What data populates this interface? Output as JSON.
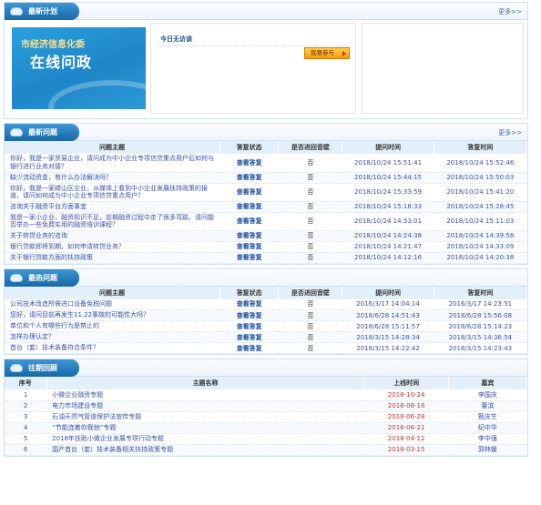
{
  "plan": {
    "title": "最新计划",
    "more": "更多>>",
    "banner_line1": "市经济信息化委",
    "banner_line2": "在线问政",
    "today": "今日无访谈",
    "join": "我要参与"
  },
  "latest": {
    "title": "最新问题",
    "more": "更多>>",
    "headers": [
      "问题主题",
      "答复状态",
      "是否进回音壁",
      "提问时间",
      "答复时间"
    ],
    "rows": [
      {
        "q": "你好，我是一家贸易企业，请问成为中小企业专项信贷重点用户后如何与银行进行业务对接？",
        "status": "查看答复",
        "wall": "否",
        "ask": "2018/10/24 15:51:41",
        "reply": "2018/10/24 15:52:46"
      },
      {
        "q": "缺少流动资金，有什么办法解决吗？",
        "status": "查看答复",
        "wall": "否",
        "ask": "2018/10/24 15:44:15",
        "reply": "2018/10/24 15:50:03"
      },
      {
        "q": "你好，我是一家崂山区企业，从媒体上看到中小企业发展扶持政策的报道，请问如何成为中小企业专项信贷重点用户？",
        "status": "查看答复",
        "wall": "否",
        "ask": "2018/10/24 15:33:59",
        "reply": "2018/10/24 15:41:20"
      },
      {
        "q": "咨询关于融资平台方面事宜",
        "status": "查看答复",
        "wall": "否",
        "ask": "2018/10/24 15:18:33",
        "reply": "2018/10/24 15:28:45"
      },
      {
        "q": "我是一家小企业，融资知识不足，前期融资过程中走了很多弯路，请问能否举办一些免费实用的融资培训课程？",
        "status": "查看答复",
        "wall": "否",
        "ask": "2018/10/24 14:53:01",
        "reply": "2018/10/24 15:11:03"
      },
      {
        "q": "关于转贷业务的咨询",
        "status": "查看答复",
        "wall": "否",
        "ask": "2018/10/24 14:24:38",
        "reply": "2018/10/24 14:39:58"
      },
      {
        "q": "银行贷款即将到期，如何申请转贷业务？",
        "status": "查看答复",
        "wall": "否",
        "ask": "2018/10/24 14:21:47",
        "reply": "2018/10/24 14:33:09"
      },
      {
        "q": "关于银行贷款方面的扶持政策",
        "status": "查看答复",
        "wall": "否",
        "ask": "2018/10/24 14:12:16",
        "reply": "2018/10/24 14:20:38"
      }
    ]
  },
  "hot": {
    "title": "最热问题",
    "headers": [
      "问题主题",
      "答复状态",
      "是否进回音壁",
      "提问时间",
      "答复时间"
    ],
    "rows": [
      {
        "q": "公司技术改造所需进口设备免税问题",
        "status": "查看答复",
        "wall": "否",
        "ask": "2016/3/17 14:04:14",
        "reply": "2016/3/17 14:23:51"
      },
      {
        "q": "您好，请问目前再发生11.22事故的可能性大吗？",
        "status": "查看答复",
        "wall": "否",
        "ask": "2018/6/28 14:51:43",
        "reply": "2018/6/28 15:56:08"
      },
      {
        "q": "单位和个人有哪些行为是禁止的",
        "status": "查看答复",
        "wall": "否",
        "ask": "2018/6/28 15:11:57",
        "reply": "2018/6/28 15:14:23"
      },
      {
        "q": "怎样办理认定？",
        "status": "查看答复",
        "wall": "否",
        "ask": "2018/3/15 14:28:34",
        "reply": "2018/3/15 14:36:54"
      },
      {
        "q": "首台（套）技术装备符合条件？",
        "status": "查看答复",
        "wall": "否",
        "ask": "2018/3/15 14:22:42",
        "reply": "2018/3/15 14:23:43"
      }
    ]
  },
  "review": {
    "title": "往期回顾",
    "headers": [
      "序号",
      "主题名称",
      "上线时间",
      "嘉宾"
    ],
    "rows": [
      {
        "n": "1",
        "topic": "小微企业融资专题",
        "date": "2018-10-24",
        "guest": "李国庆"
      },
      {
        "n": "2",
        "topic": "电力市场建设专题",
        "date": "2018-08-16",
        "guest": "董滨"
      },
      {
        "n": "3",
        "topic": "石油天然气管道保护法宣传专题",
        "date": "2018-06-28",
        "guest": "甄庆生"
      },
      {
        "n": "4",
        "topic": "“节能连着你我他”专题",
        "date": "2018-06-21",
        "guest": "纪中华"
      },
      {
        "n": "5",
        "topic": "2018年扶助小微企业发展专项行动专题",
        "date": "2018-04-12",
        "guest": "李中强"
      },
      {
        "n": "6",
        "topic": "国产首台（套）技术装备相关扶持政策专题",
        "date": "2018-03-15",
        "guest": "郭林媛"
      }
    ]
  }
}
